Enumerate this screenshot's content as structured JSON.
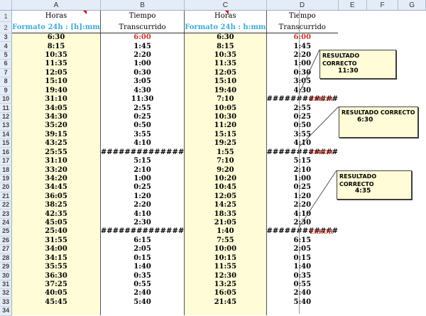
{
  "columns": [
    "A",
    "B",
    "C",
    "D",
    "E",
    "F",
    "G"
  ],
  "header": {
    "a1": "Horas",
    "a2": "Formato 24h : [h]:mm",
    "b1": "Tiempo",
    "b2": "Transcurrido",
    "c1": "Horas",
    "c2": "Formato 24h : h:mm",
    "d1": "Tiempo",
    "d2": "Transcurrido"
  },
  "rows": [
    [
      "6:30",
      "6:00",
      "6:30",
      "6:00"
    ],
    [
      "8:15",
      "1:45",
      "8:15",
      "1:45"
    ],
    [
      "10:35",
      "2:20",
      "10:35",
      "2:20"
    ],
    [
      "11:35",
      "1:00",
      "11:35",
      "1:00"
    ],
    [
      "12:05",
      "0:30",
      "12:05",
      "0:30"
    ],
    [
      "15:10",
      "3:05",
      "15:10",
      "3:05"
    ],
    [
      "19:40",
      "4:30",
      "19:40",
      "4:30"
    ],
    [
      "31:10",
      "11:30",
      "7:10",
      "############"
    ],
    [
      "34:05",
      "2:55",
      "10:05",
      "2:55"
    ],
    [
      "34:30",
      "0:25",
      "10:30",
      "0:25"
    ],
    [
      "35:20",
      "0:50",
      "11:20",
      "0:50"
    ],
    [
      "39:15",
      "3:55",
      "15:15",
      "3:55"
    ],
    [
      "43:25",
      "4:10",
      "19:25",
      "4:10"
    ],
    [
      "25:55",
      "##############",
      "1:55",
      "############"
    ],
    [
      "31:10",
      "5:15",
      "7:10",
      "5:15"
    ],
    [
      "33:20",
      "2:10",
      "9:20",
      "2:10"
    ],
    [
      "34:20",
      "1:00",
      "10:20",
      "1:00"
    ],
    [
      "34:45",
      "0:25",
      "10:45",
      "0:25"
    ],
    [
      "36:05",
      "1:20",
      "12:05",
      "1:20"
    ],
    [
      "38:25",
      "2:20",
      "14:25",
      "2:20"
    ],
    [
      "42:35",
      "4:10",
      "18:35",
      "4:10"
    ],
    [
      "45:05",
      "2:30",
      "21:05",
      "2:30"
    ],
    [
      "25:40",
      "##############",
      "1:40",
      "############"
    ],
    [
      "31:55",
      "6:15",
      "7:55",
      "6:15"
    ],
    [
      "34:00",
      "2:05",
      "10:00",
      "2:05"
    ],
    [
      "34:15",
      "0:15",
      "10:15",
      "0:15"
    ],
    [
      "35:55",
      "1:40",
      "11:55",
      "1:40"
    ],
    [
      "36:30",
      "0:35",
      "12:30",
      "0:35"
    ],
    [
      "37:25",
      "0:55",
      "13:25",
      "0:55"
    ],
    [
      "40:05",
      "2:40",
      "16:05",
      "2:40"
    ],
    [
      "45:45",
      "5:40",
      "21:45",
      "5:40"
    ]
  ],
  "error_label": "ERROR",
  "callouts": [
    {
      "title": "RESULTADO CORRECTO",
      "value": "11:30"
    },
    {
      "title": "RESULTADO CORRECTO",
      "value": "6:30"
    },
    {
      "title": "RESULTADO CORRECTO",
      "value": "4:35"
    }
  ]
}
